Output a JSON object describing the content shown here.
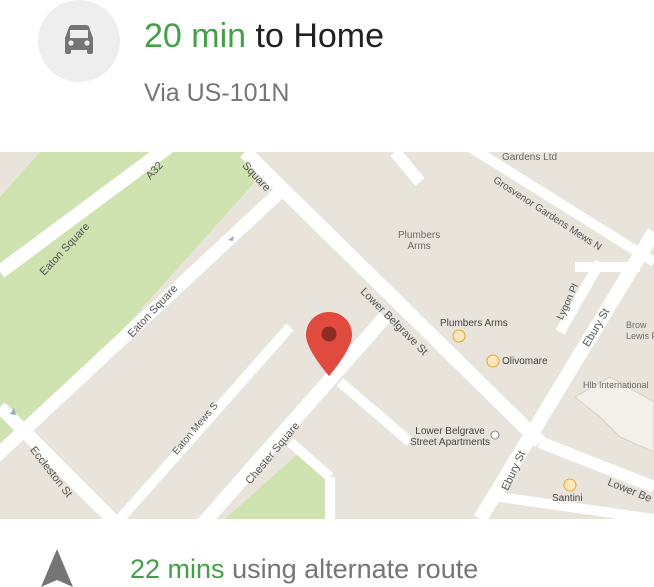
{
  "header": {
    "duration": "20 min",
    "destination": "to Home",
    "route": "Via US-101N"
  },
  "map": {
    "streets": {
      "eaton_square_1": "Eaton Square",
      "eaton_square_2": "Eaton Square",
      "a32": "A32",
      "square_top": "Square",
      "grosvenor": "Grosvenor Gardens Mews N",
      "lower_belgrave": "Lower Belgrave St",
      "lygon": "Lygon Pl",
      "ebury_1": "Ebury St",
      "ebury_2": "Ebury St",
      "eaton_mews": "Eaton Mews S",
      "chester": "Chester Square",
      "eccleston": "Eccleston St",
      "lower_be": "Lower Be"
    },
    "pois": {
      "gardens_ltd": "Gardens Ltd",
      "plumbers_arms_label": "Plumbers\nArms",
      "plumbers_arms": "Plumbers Arms",
      "olivomare": "Olivomare",
      "hlb": "Hlb International",
      "brow": "Brow\nLewis F",
      "apartments": "Lower Belgrave\nStreet Apartments",
      "santini": "Santini"
    }
  },
  "footer": {
    "alt_time": "22 mins",
    "alt_text": "using alternate route"
  },
  "colors": {
    "accent_green": "#43a047",
    "pin_red": "#e04a3f",
    "park_green": "#cfe3b0"
  }
}
